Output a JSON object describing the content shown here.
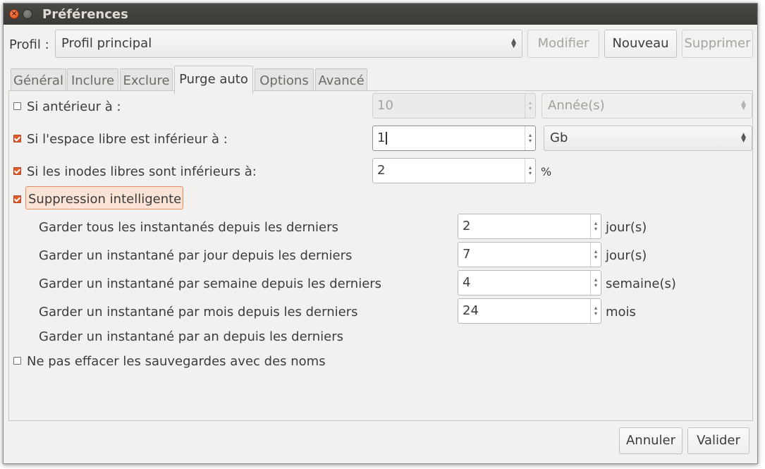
{
  "window": {
    "title": "Préférences"
  },
  "profile": {
    "label": "Profil :",
    "selected": "Profil principal",
    "buttons": {
      "modify": "Modifier",
      "new": "Nouveau",
      "delete": "Supprimer"
    }
  },
  "tabs": [
    "Général",
    "Inclure",
    "Exclure",
    "Purge auto",
    "Options",
    "Avancé"
  ],
  "active_tab": "Purge auto",
  "rules": {
    "older_than": {
      "label": "Si antérieur à :",
      "checked": false,
      "value": "10",
      "unit": "Année(s)"
    },
    "free_space": {
      "label": "Si l'espace libre est inférieur à :",
      "checked": true,
      "value": "1",
      "unit": "Gb"
    },
    "free_inodes": {
      "label": "Si les inodes libres sont inférieurs à:",
      "checked": true,
      "value": "2",
      "unit": "%"
    },
    "smart_remove": {
      "label": "Suppression intelligente",
      "checked": true,
      "keep_all": {
        "label": "Garder tous les instantanés depuis les derniers",
        "value": "2",
        "unit": "jour(s)"
      },
      "per_day": {
        "label": "Garder un instantané par jour depuis les derniers",
        "value": "7",
        "unit": "jour(s)"
      },
      "per_week": {
        "label": "Garder un instantané par semaine depuis les derniers",
        "value": "4",
        "unit": "semaine(s)"
      },
      "per_month": {
        "label": "Garder un instantané par mois depuis les derniers",
        "value": "24",
        "unit": "mois"
      },
      "per_year": {
        "label": "Garder un instantané par an depuis les derniers"
      }
    },
    "dont_remove_named": {
      "label": "Ne pas effacer les sauvegardes avec des noms",
      "checked": false
    }
  },
  "footer": {
    "cancel": "Annuler",
    "ok": "Valider"
  },
  "colors": {
    "accent": "#dd5b2c",
    "titlebar": "#3c3b37",
    "window_bg": "#f2f1f0"
  }
}
